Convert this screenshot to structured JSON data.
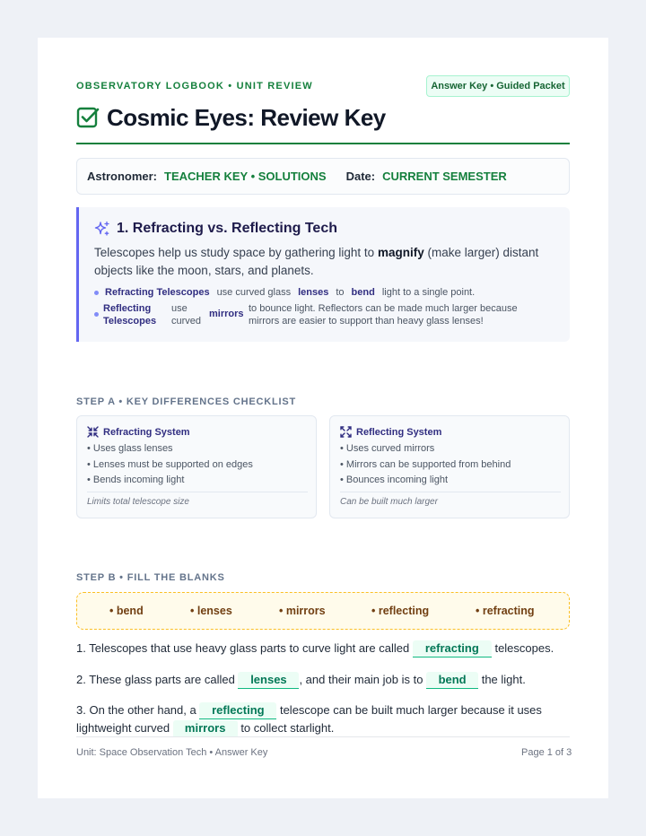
{
  "header": {
    "eyebrow": "OBSERVATORY LOGBOOK • UNIT REVIEW",
    "badge": "Answer Key • Guided Packet",
    "title": "Cosmic Eyes: Review Key",
    "title_icon": "checkbox-icon"
  },
  "meta": {
    "astronomer_label": "Astronomer:",
    "astronomer_value": "TEACHER KEY • SOLUTIONS",
    "date_label": "Date:",
    "date_value": "CURRENT SEMESTER"
  },
  "callout": {
    "icon": "sparkles-icon",
    "title": "1. Refracting vs. Reflecting Tech",
    "body_1": "Telescopes help us study space by gathering light to",
    "body_bold": "magnify",
    "body_2": "(make larger) distant objects like the moon, stars, and planets.",
    "b1_term": "Refracting Telescopes",
    "b1_a": "use curved glass",
    "b1_k1": "lenses",
    "b1_b": "to",
    "b1_k2": "bend",
    "b1_c": "light to a single point.",
    "b2_term_1": "Reflecting",
    "b2_term_2": "Telescopes",
    "b2_a1": "use",
    "b2_a2": "curved",
    "b2_k": "mirrors",
    "b2_c1": "to bounce light. Reflectors can be made much larger because",
    "b2_c2": "mirrors are easier to support than heavy glass lenses!"
  },
  "step_a": {
    "title": "STEP A • KEY DIFFERENCES CHECKLIST",
    "cards": [
      {
        "icon": "collapse-arrows-icon",
        "title": "Refracting System",
        "items": [
          "• Uses glass lenses",
          "• Lenses must be supported on edges",
          "• Bends incoming light"
        ],
        "note": "Limits total telescope size"
      },
      {
        "icon": "expand-arrows-icon",
        "title": "Reflecting System",
        "items": [
          "• Uses curved mirrors",
          "• Mirrors can be supported from behind",
          "• Bounces incoming light"
        ],
        "note": "Can be built much larger"
      }
    ]
  },
  "step_b": {
    "title": "STEP B • FILL THE BLANKS",
    "word_bank": [
      "• bend",
      "• lenses",
      "• mirrors",
      "• reflecting",
      "• refracting"
    ],
    "q1": {
      "a": "1. Telescopes that use heavy glass parts to curve light are called",
      "blank": "refracting",
      "b": "telescopes."
    },
    "q2": {
      "a": "2. These glass parts are called",
      "blank1": "lenses",
      "b": ", and their main job is to",
      "blank2": "bend",
      "c": "the light."
    },
    "q3": {
      "a": "3. On the other hand, a",
      "blank1": "reflecting",
      "b": "telescope can be built much larger because it uses",
      "c": "lightweight curved",
      "blank2": "mirrors",
      "d": "to collect starlight."
    }
  },
  "footer": {
    "left": "Unit: Space Observation Tech • Answer Key",
    "right": "Page 1 of 3"
  },
  "colors": {
    "accent_green": "#15803d",
    "accent_indigo": "#6366f1",
    "word_bank_border": "#fbbf24"
  }
}
